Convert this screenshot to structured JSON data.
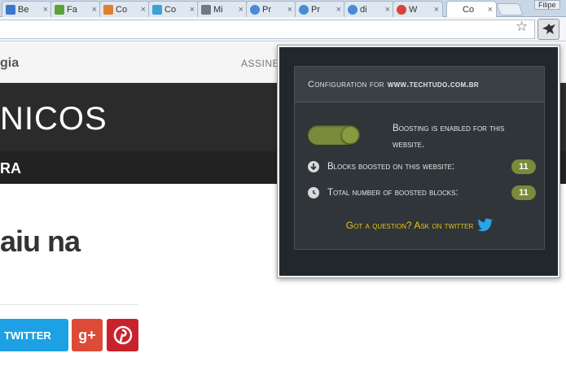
{
  "browser": {
    "tabs": [
      {
        "title": "Be",
        "fav_color": "#3b78c9"
      },
      {
        "title": "Fa",
        "fav_color": "#5aa33a"
      },
      {
        "title": "Co",
        "fav_color": "#e0802c"
      },
      {
        "title": "Co",
        "fav_color": "#3fa0d8"
      },
      {
        "title": "Mi",
        "fav_color": "#6e7a88"
      },
      {
        "title": "Pr",
        "fav_color": "#4a8bd6"
      },
      {
        "title": "Pr",
        "fav_color": "#4a8bd6"
      },
      {
        "title": "di",
        "fav_color": "#4a8bd6"
      },
      {
        "title": "W",
        "fav_color": "#d4463a"
      },
      {
        "title": "Co",
        "fav_color": "#ffffff"
      }
    ],
    "tab_close": "×",
    "profile_name": "Filipe"
  },
  "page": {
    "brand_text": "gia",
    "nav_assine": "ASSINE",
    "hero_text": "NICOS",
    "subnav_text": "RA",
    "headline": "aiu na",
    "share": {
      "twitter_label": "TWITTER",
      "gplus_label": "g+"
    }
  },
  "popup": {
    "header_prefix": "Configuration for",
    "header_host": "www.techtudo.com.br",
    "toggle_on": true,
    "status_text": "Boosting is enabled for this website.",
    "stats": [
      {
        "label": "Blocks boosted on this website:",
        "value": "11",
        "icon": "download-circle-icon"
      },
      {
        "label": "Total number of boosted blocks:",
        "value": "11",
        "icon": "clock-icon"
      }
    ],
    "question_text": "Got a question? Ask on twitter"
  },
  "colors": {
    "accent_green": "#7c8a3b",
    "question_yellow": "#e8c414",
    "twitter_blue": "#1da1e4"
  }
}
